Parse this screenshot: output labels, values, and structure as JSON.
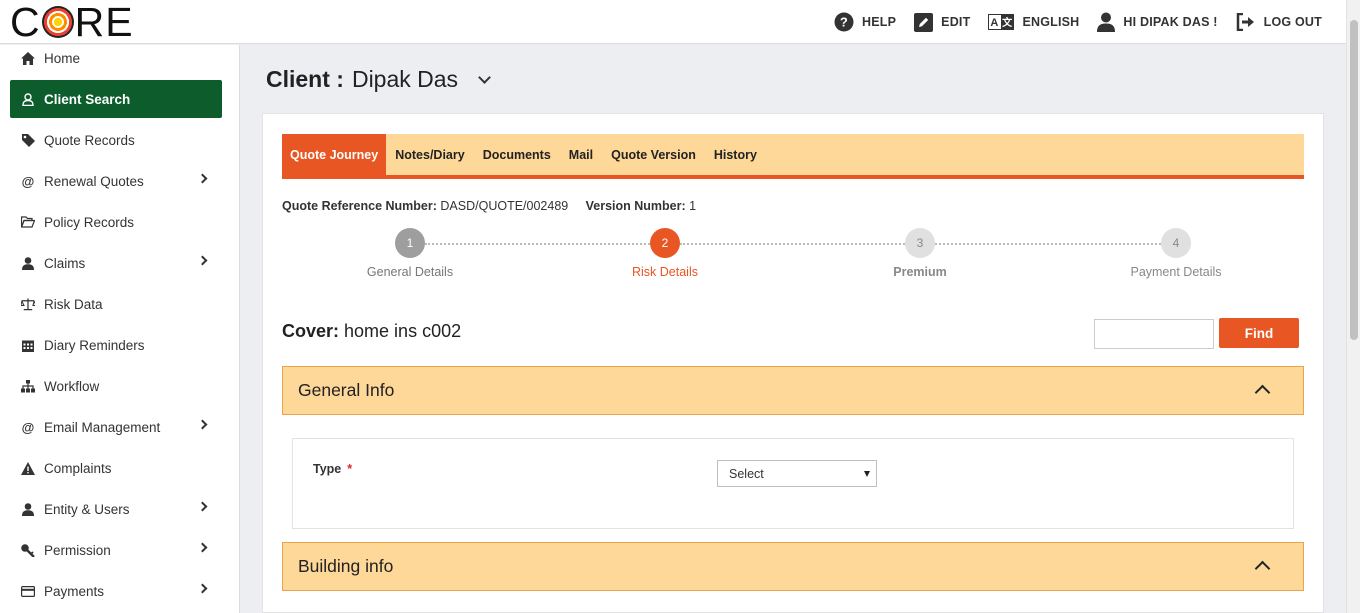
{
  "brand": {
    "logo_left": "C",
    "logo_right": "RE"
  },
  "topnav": {
    "help": "HELP",
    "edit": "EDIT",
    "language": "ENGLISH",
    "greeting": "HI DIPAK DAS !",
    "logout": "LOG OUT"
  },
  "sidebar": {
    "items": [
      {
        "label": "Home",
        "icon": "home-icon",
        "has_submenu": false,
        "active": false
      },
      {
        "label": "Client Search",
        "icon": "user-icon",
        "has_submenu": false,
        "active": true
      },
      {
        "label": "Quote Records",
        "icon": "tag-icon",
        "has_submenu": false,
        "active": false
      },
      {
        "label": "Renewal Quotes",
        "icon": "at-icon",
        "has_submenu": true,
        "active": false
      },
      {
        "label": "Policy Records",
        "icon": "folder-open-icon",
        "has_submenu": false,
        "active": false
      },
      {
        "label": "Claims",
        "icon": "person-icon",
        "has_submenu": true,
        "active": false
      },
      {
        "label": "Risk Data",
        "icon": "scale-icon",
        "has_submenu": false,
        "active": false
      },
      {
        "label": "Diary Reminders",
        "icon": "calendar-icon",
        "has_submenu": false,
        "active": false
      },
      {
        "label": "Workflow",
        "icon": "sitemap-icon",
        "has_submenu": false,
        "active": false
      },
      {
        "label": "Email Management",
        "icon": "at-icon",
        "has_submenu": true,
        "active": false
      },
      {
        "label": "Complaints",
        "icon": "warning-icon",
        "has_submenu": false,
        "active": false
      },
      {
        "label": "Entity & Users",
        "icon": "person-icon",
        "has_submenu": true,
        "active": false
      },
      {
        "label": "Permission",
        "icon": "key-icon",
        "has_submenu": true,
        "active": false
      },
      {
        "label": "Payments",
        "icon": "credit-card-icon",
        "has_submenu": true,
        "active": false
      }
    ]
  },
  "client": {
    "label": "Client :",
    "name": "Dipak Das"
  },
  "tabs": [
    {
      "label": "Quote Journey",
      "active": true
    },
    {
      "label": "Notes/Diary",
      "active": false
    },
    {
      "label": "Documents",
      "active": false
    },
    {
      "label": "Mail",
      "active": false
    },
    {
      "label": "Quote Version",
      "active": false
    },
    {
      "label": "History",
      "active": false
    }
  ],
  "quote": {
    "ref_label": "Quote Reference Number:",
    "ref_value": "DASD/QUOTE/002489",
    "version_label": "Version Number:",
    "version_value": "1"
  },
  "steps": [
    {
      "num": "1",
      "label": "General Details",
      "state": "done"
    },
    {
      "num": "2",
      "label": "Risk Details",
      "state": "current"
    },
    {
      "num": "3",
      "label": "Premium",
      "state": "pending"
    },
    {
      "num": "4",
      "label": "Payment Details",
      "state": "pending"
    }
  ],
  "cover": {
    "label": "Cover:",
    "value": "home ins c002"
  },
  "find": {
    "input_value": "",
    "button_label": "Find"
  },
  "sections": {
    "general_info": "General Info",
    "building_info": "Building info"
  },
  "form": {
    "type_label": "Type",
    "required_mark": "*",
    "type_selected": "Select"
  },
  "colors": {
    "accent": "#e85623",
    "tab_bar": "#fdd899",
    "sidebar_active": "#0d5c2c",
    "step_done": "#9e9e9e",
    "step_pending": "#e0e0e0"
  }
}
